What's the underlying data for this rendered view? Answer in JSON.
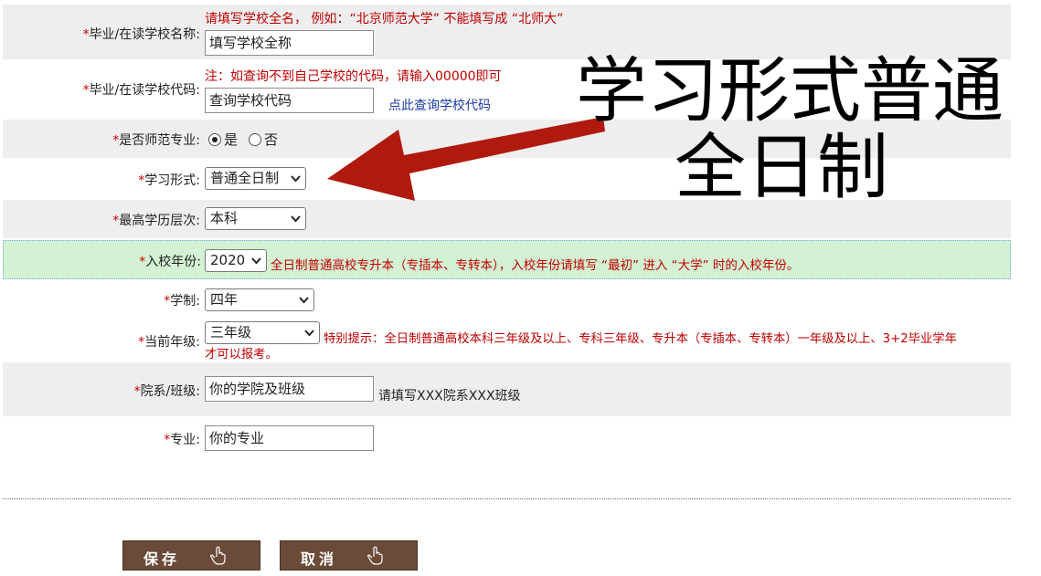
{
  "form": {
    "school_name": {
      "label": "毕业/在读学校名称:",
      "hint": "请填写学校全名，  例如：“北京师范大学” 不能填写成 “北师大”",
      "value": "填写学校全称"
    },
    "school_code": {
      "label": "毕业/在读学校代码:",
      "hint": "注：如查询不到自己学校的代码，请输入00000即可",
      "value": "查询学校代码",
      "lookup_link": "点此查询学校代码"
    },
    "is_teacher_major": {
      "label": "是否师范专业:",
      "options": [
        "是",
        "否"
      ],
      "selected": "是"
    },
    "study_form": {
      "label": "学习形式:",
      "value": "普通全日制"
    },
    "education_level": {
      "label": "最高学历层次:",
      "value": "本科"
    },
    "enroll_year": {
      "label": "入校年份:",
      "value": "2020",
      "hint": "全日制普通高校专升本（专插本、专转本），入校年份请填写 “最初” 进入 “大学” 时的入校年份。"
    },
    "duration": {
      "label": "学制:",
      "value": "四年"
    },
    "current_grade": {
      "label": "当前年级:",
      "value": "三年级",
      "hint_line1": "特别提示：全日制普通高校本科三年级及以上、专科三年级、专升本（专插本、专转本）一年级及以上、3+2毕业学年",
      "hint_line2": "才可以报考。"
    },
    "department_class": {
      "label": "院系/班级:",
      "value": "你的学院及班级",
      "hint": "请填写XXX院系XXX班级"
    },
    "major": {
      "label": "专业:",
      "value": "你的专业"
    },
    "required_mark": "*"
  },
  "annotation": {
    "line1": "学习形式普通",
    "line2": "全日制",
    "arrow_color": "#b01a0e"
  },
  "buttons": {
    "save": "保存",
    "cancel": "取消"
  },
  "colors": {
    "hint_red": "#c00000",
    "button_brown": "#6a4a38",
    "highlight_green": "#d3f1d3",
    "row_grey": "#eeeeee"
  }
}
